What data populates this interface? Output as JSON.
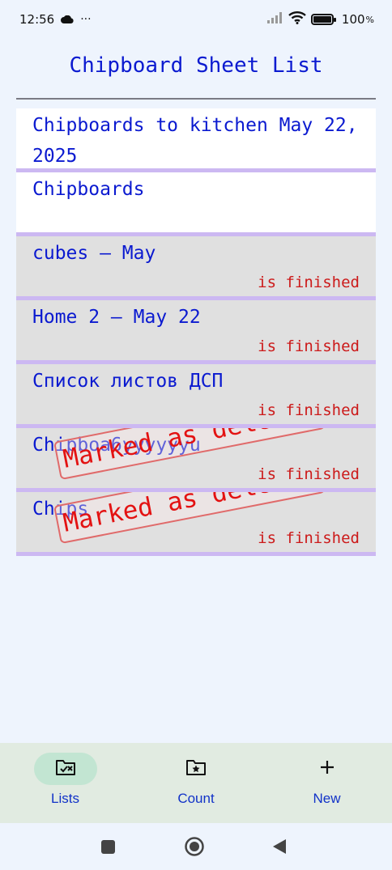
{
  "status_bar": {
    "time": "12:56",
    "more": "···",
    "battery": "100"
  },
  "header": {
    "title": "Chipboard Sheet List"
  },
  "sheets": [
    {
      "name": "Chipboards to kitchen May 22, 2025",
      "status": "",
      "deleted_stamp": ""
    },
    {
      "name": "Chipboards",
      "status": "",
      "deleted_stamp": ""
    },
    {
      "name": "cubes – May",
      "status": "is finished",
      "deleted_stamp": ""
    },
    {
      "name": "Home 2 – May 22",
      "status": "is finished",
      "deleted_stamp": ""
    },
    {
      "name": "Список листов ДСП",
      "status": "is finished",
      "deleted_stamp": ""
    },
    {
      "name": "Chipboa6yyyyyyu",
      "status": "is finished",
      "deleted_stamp": "Marked as deleted"
    },
    {
      "name": "Chips",
      "status": "is finished",
      "deleted_stamp": "Marked as deleted"
    }
  ],
  "bottom_nav": {
    "lists_label": "Lists",
    "count_label": "Count",
    "new_label": "New"
  },
  "colors": {
    "accent": "#0b1ad0",
    "finished_text": "#cc1a1a",
    "divider": "#ccb8f2",
    "finished_bg": "#e0e0e0",
    "nav_active": "#c2e5d2"
  }
}
